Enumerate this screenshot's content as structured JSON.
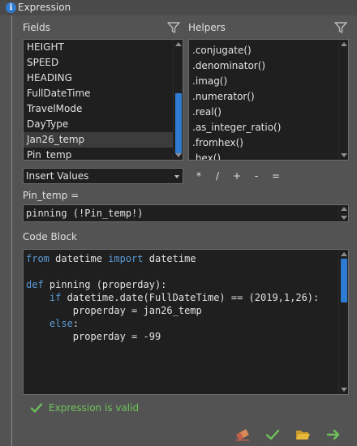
{
  "window": {
    "title": "Expression"
  },
  "fields": {
    "label": "Fields",
    "items": [
      "HEIGHT",
      "SPEED",
      "HEADING",
      "FullDateTime",
      "TravelMode",
      "DayType",
      "Jan26_temp",
      "Pin_temp"
    ],
    "selected": "Jan26_temp"
  },
  "helpers": {
    "label": "Helpers",
    "items": [
      ".conjugate()",
      ".denominator()",
      ".imag()",
      ".numerator()",
      ".real()",
      ".as_integer_ratio()",
      ".fromhex()",
      ".hex()"
    ]
  },
  "insert_values": {
    "value": "Insert Values"
  },
  "operators": [
    "*",
    "/",
    "+",
    "-",
    "="
  ],
  "expression": {
    "label": "Pin_temp =",
    "value": "pinning (!Pin_temp!)"
  },
  "code_block": {
    "label": "Code Block",
    "lines": [
      "from datetime import datetime",
      "",
      "def pinning (properday):",
      "    if datetime.date(FullDateTime) == (2019,1,26):",
      "        properday = jan26_temp",
      "    else:",
      "        properday = -99"
    ]
  },
  "status": {
    "message": "Expression is valid",
    "color": "#6ec45a"
  },
  "toolbar": {
    "icons": [
      "eraser-icon",
      "checkmark-icon",
      "open-folder-icon",
      "arrow-right-icon"
    ]
  },
  "colors": {
    "accent": "#2f7bd3",
    "keyword": "#5b9bd5",
    "valid": "#6ec45a",
    "panel": "#535353",
    "input": "#1f1f1f"
  }
}
